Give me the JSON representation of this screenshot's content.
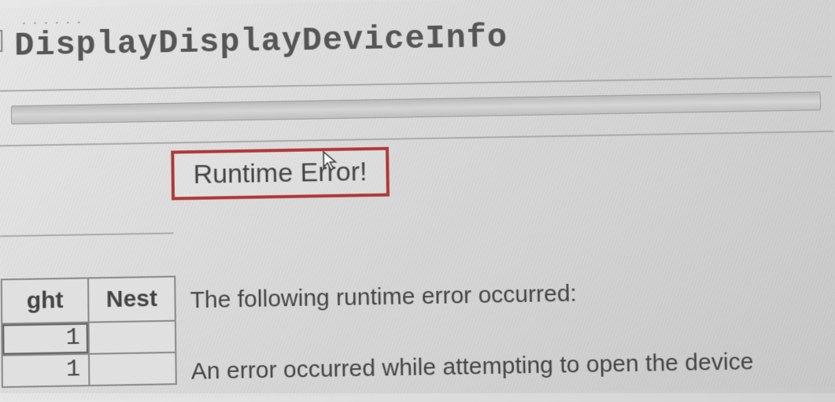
{
  "title": "DisplayDisplayDeviceInfo",
  "decoration_dots": ". . . . . .",
  "error": {
    "heading": "Runtime Error!",
    "line1": "The following runtime error occurred:",
    "line2": "An error occurred while attempting to open the device"
  },
  "table": {
    "headers": [
      "ght",
      "Nest"
    ],
    "rows": [
      [
        "1",
        ""
      ],
      [
        "1",
        ""
      ]
    ]
  },
  "colors": {
    "highlight_border": "#b03838"
  }
}
